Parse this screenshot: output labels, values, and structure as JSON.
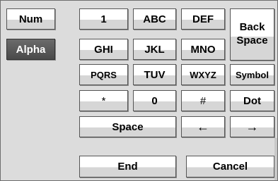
{
  "mode": {
    "num_label": "Num",
    "alpha_label": "Alpha",
    "active": "Alpha"
  },
  "keys": {
    "row1": [
      "1",
      "ABC",
      "DEF"
    ],
    "row2": [
      "GHI",
      "JKL",
      "MNO"
    ],
    "row3": [
      "PQRS",
      "TUV",
      "WXYZ",
      "Symbol"
    ],
    "row4": [
      "*",
      "0",
      "#",
      "Dot"
    ],
    "space_label": "Space",
    "left_arrow": "←",
    "right_arrow": "→",
    "backspace_line1": "Back",
    "backspace_line2": "Space"
  },
  "actions": {
    "end_label": "End",
    "cancel_label": "Cancel"
  }
}
